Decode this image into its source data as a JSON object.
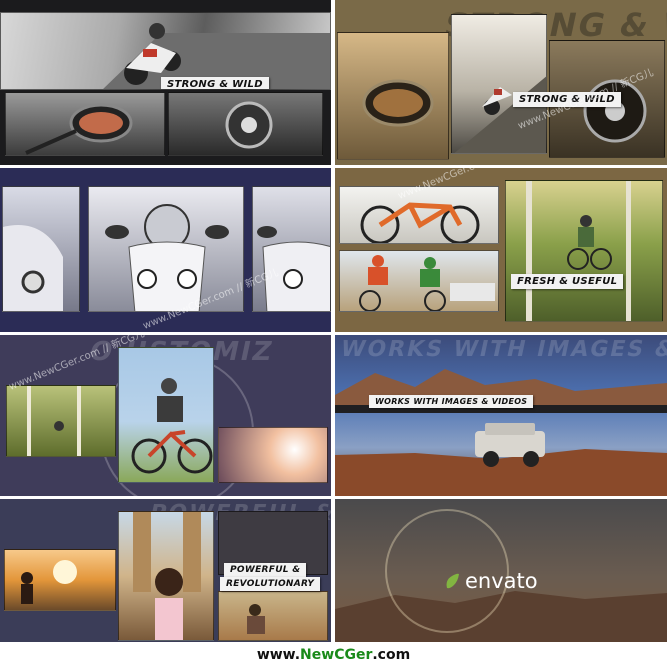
{
  "panels": {
    "p1": {
      "caption": "STRONG & WILD"
    },
    "p2": {
      "caption": "STRONG & WILD",
      "ghost": "STRONG & W"
    },
    "p4": {
      "caption": "FRESH & USEFUL"
    },
    "p5": {
      "ghost": "O USTOMIZ"
    },
    "p6": {
      "caption": "WORKS WITH IMAGES & VIDEOS",
      "ghost": "WORKS WITH IMAGES & VIDEO"
    },
    "p7": {
      "caption_line1": "POWERFUL &",
      "caption_line2": "REVOLUTIONARY",
      "ghost": "POWERFUL &"
    },
    "p8": {
      "brand": "envato"
    }
  },
  "watermark": {
    "text": "www.NewCGer.com // 新CG儿",
    "footer_pre": "www.",
    "footer_mid": "NewCGer",
    "footer_post": ".com",
    "colors": {
      "pre": "#111111",
      "mid": "#1a8a1a",
      "post": "#111111"
    }
  },
  "colors": {
    "envato_leaf": "#82b541"
  }
}
